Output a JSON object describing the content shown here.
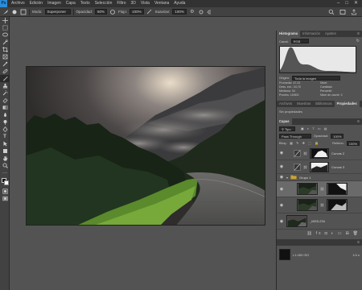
{
  "menu": {
    "items": [
      "Archivo",
      "Edición",
      "Imagen",
      "Capa",
      "Texto",
      "Selección",
      "Filtro",
      "3D",
      "Vista",
      "Ventana",
      "Ayuda"
    ],
    "window_controls": [
      "–",
      "□",
      "✕"
    ]
  },
  "options_bar": {
    "mode_label": "Modo:",
    "mode_value": "Superponer",
    "opacity_label": "Opacidad:",
    "opacity_value": "50%",
    "flow_label": "Flujo:",
    "flow_value": "100%",
    "smoothing_label": "Suavizar:",
    "smoothing_value": "100%"
  },
  "toolbar": {
    "tools": [
      "move-tool",
      "marquee-tool",
      "lasso-tool",
      "quick-select-tool",
      "crop-tool",
      "frame-tool",
      "eyedropper-tool",
      "healing-tool",
      "brush-tool",
      "clone-stamp-tool",
      "history-brush-tool",
      "eraser-tool",
      "gradient-tool",
      "blur-tool",
      "dodge-tool",
      "pen-tool",
      "type-tool",
      "path-select-tool",
      "shape-tool",
      "hand-tool",
      "zoom-tool",
      "more-tools"
    ],
    "active_tool": "brush-tool"
  },
  "histogram_panel": {
    "tabs": [
      "Histograma",
      "Información",
      "Ajustes"
    ],
    "channel_label": "Canal:",
    "channel_value": "RGB",
    "source_label": "Origen:",
    "source_value": "Toda la imagen",
    "stats": [
      {
        "label": "Promedio:",
        "value": "47,31"
      },
      {
        "label": "Desv. est.:",
        "value": "34,75"
      },
      {
        "label": "Mediana:",
        "value": "34"
      },
      {
        "label": "Píxeles:",
        "value": "16'800"
      },
      {
        "label": "Nivel:",
        "value": ""
      },
      {
        "label": "Cantidad:",
        "value": ""
      },
      {
        "label": "Percentil:",
        "value": ""
      },
      {
        "label": "Nivel de caché:",
        "value": "2"
      }
    ]
  },
  "properties_panel": {
    "tabs": [
      "Archivos",
      "Muestras",
      "Bibliotecas",
      "Propiedades"
    ],
    "empty_text": "Sin propiedades"
  },
  "layers_panel": {
    "tab": "Capas",
    "filter_label": "Tipo",
    "blend_mode": "Pass Through",
    "opacity_label": "Opacidad:",
    "opacity_value": "100%",
    "lock_label": "Bloq.:",
    "fill_label": "Relleno:",
    "fill_value": "100%",
    "layers": [
      {
        "name": "Curvas 2",
        "type": "adjustment"
      },
      {
        "name": "Curvas 3",
        "type": "adjustment"
      },
      {
        "name": "Grupo 1",
        "type": "group"
      },
      {
        "name": "",
        "type": "smart-with-mask"
      },
      {
        "name": "",
        "type": "smart-with-mask"
      },
      {
        "name": "_MG5-234",
        "type": "image"
      }
    ]
  },
  "bottom_panel": {
    "label": "L1.083 ISO",
    "value": "1/4 s"
  },
  "colors": {
    "ps_blue": "#2d8cd8",
    "panel_bg": "#535353",
    "dark_bar": "#323232"
  }
}
